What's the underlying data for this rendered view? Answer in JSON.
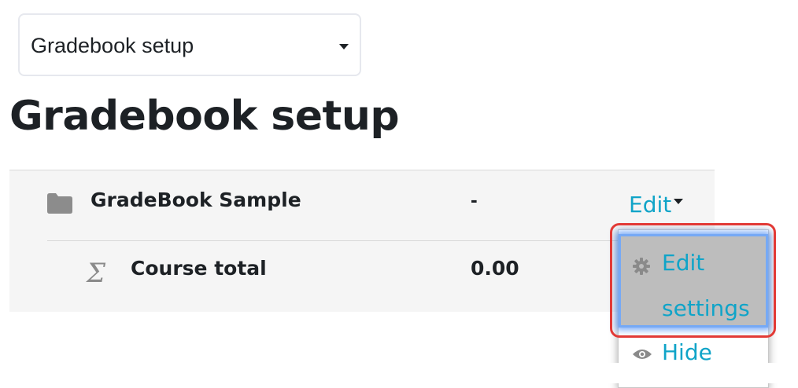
{
  "nav_select": {
    "selected": "Gradebook setup"
  },
  "page": {
    "title": "Gradebook setup"
  },
  "category_row": {
    "name": "GradeBook Sample",
    "value": "-",
    "edit_label": "Edit"
  },
  "total_row": {
    "name": "Course total",
    "value": "0.00",
    "icon": "sigma-icon"
  },
  "edit_menu": {
    "items": [
      {
        "label_line1": "Edit",
        "label_line2": "settings",
        "icon": "gear-icon"
      },
      {
        "label": "Hide",
        "icon": "eye-icon"
      }
    ]
  },
  "colors": {
    "link": "#10a4c8",
    "highlight_border": "#e23a36",
    "focus_glow": "#76a9f5"
  }
}
